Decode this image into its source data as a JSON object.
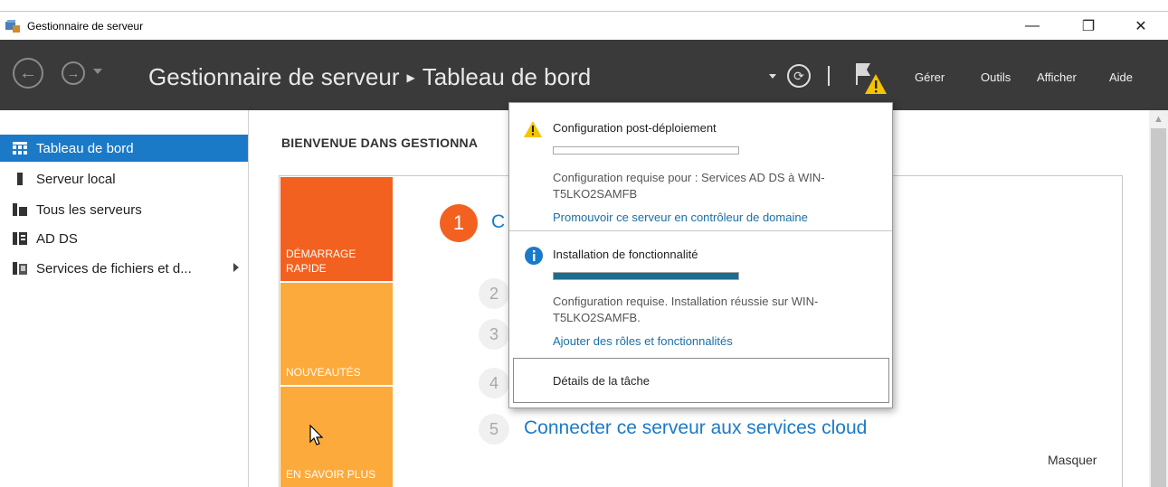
{
  "window": {
    "title": "Gestionnaire de serveur",
    "minimize_glyph": "—",
    "restore_glyph": "❐",
    "close_glyph": "✕"
  },
  "header": {
    "breadcrumb_root": "Gestionnaire de serveur",
    "breadcrumb_sep": "▶",
    "breadcrumb_page": "Tableau de bord",
    "menus": [
      "Gérer",
      "Outils",
      "Afficher",
      "Aide"
    ]
  },
  "sidebar": {
    "items": [
      {
        "label": "Tableau de bord",
        "icon": "dashboard-icon",
        "active": true
      },
      {
        "label": "Serveur local",
        "icon": "local-server-icon"
      },
      {
        "label": "Tous les serveurs",
        "icon": "all-servers-icon"
      },
      {
        "label": "AD DS",
        "icon": "ad-ds-icon"
      },
      {
        "label": "Services de fichiers et d...",
        "icon": "file-services-icon",
        "has_submenu": true
      }
    ]
  },
  "main": {
    "welcome_title": "BIENVENUE DANS GESTIONNA",
    "tiles": [
      {
        "label": "DÉMARRAGE RAPIDE",
        "color": "#f2611f"
      },
      {
        "label": "NOUVEAUTÉS",
        "color": "#fcaa3b"
      },
      {
        "label": "EN SAVOIR PLUS",
        "color": "#fcaa3b"
      }
    ],
    "steps": [
      {
        "num": "1",
        "text": "C"
      },
      {
        "num": "2",
        "text": ""
      },
      {
        "num": "3",
        "text": ""
      },
      {
        "num": "4",
        "text": ""
      },
      {
        "num": "5",
        "text": "Connecter ce serveur aux services cloud"
      }
    ],
    "hide_label": "Masquer"
  },
  "notifications": {
    "items": [
      {
        "icon": "warning-icon",
        "title": "Configuration post-déploiement",
        "progress": 0,
        "text": "Configuration requise pour : Services AD DS à WIN-T5LKO2SAMFB",
        "link": "Promouvoir ce serveur en contrôleur de domaine"
      },
      {
        "icon": "info-icon",
        "title": "Installation de fonctionnalité",
        "progress": 1,
        "text": "Configuration requise. Installation réussie sur WIN-T5LKO2SAMFB.",
        "link": "Ajouter des rôles et fonctionnalités"
      }
    ],
    "details_label": "Détails de la tâche"
  },
  "colors": {
    "header_bg": "#3a3a3a",
    "accent_blue": "#1a7ac8",
    "tile_orange": "#f2611f",
    "tile_yellow": "#fcaa3b",
    "warning_yellow": "#f5c400",
    "progress_fill": "#1b6e8e"
  }
}
